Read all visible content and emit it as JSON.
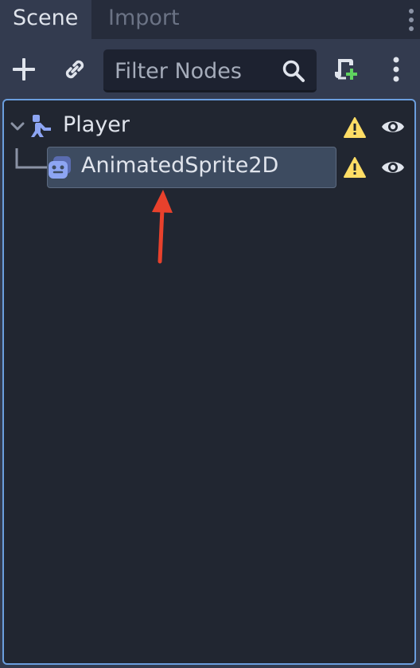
{
  "tabs": {
    "scene": "Scene",
    "import": "Import"
  },
  "toolbar": {
    "filter_placeholder": "Filter Nodes",
    "icons": [
      "plus-icon",
      "link-icon",
      "search-icon",
      "add-script-icon",
      "more-vertical-icon"
    ]
  },
  "tree": {
    "nodes": [
      {
        "label": "Player",
        "icon": "character-body-icon",
        "expanded": true,
        "warning": true,
        "visible": true
      },
      {
        "label": "AnimatedSprite2D",
        "icon": "animated-sprite-icon",
        "selected": true,
        "warning": true,
        "visible": true
      }
    ]
  },
  "colors": {
    "panel_bg": "#333b4f",
    "tree_bg": "#212631",
    "selection_bg": "#3d4b60",
    "focus_border": "#6b9ede",
    "node_icon": "#8da5f3",
    "warning": "#ffdd65",
    "annotation_arrow": "#e8412c"
  }
}
